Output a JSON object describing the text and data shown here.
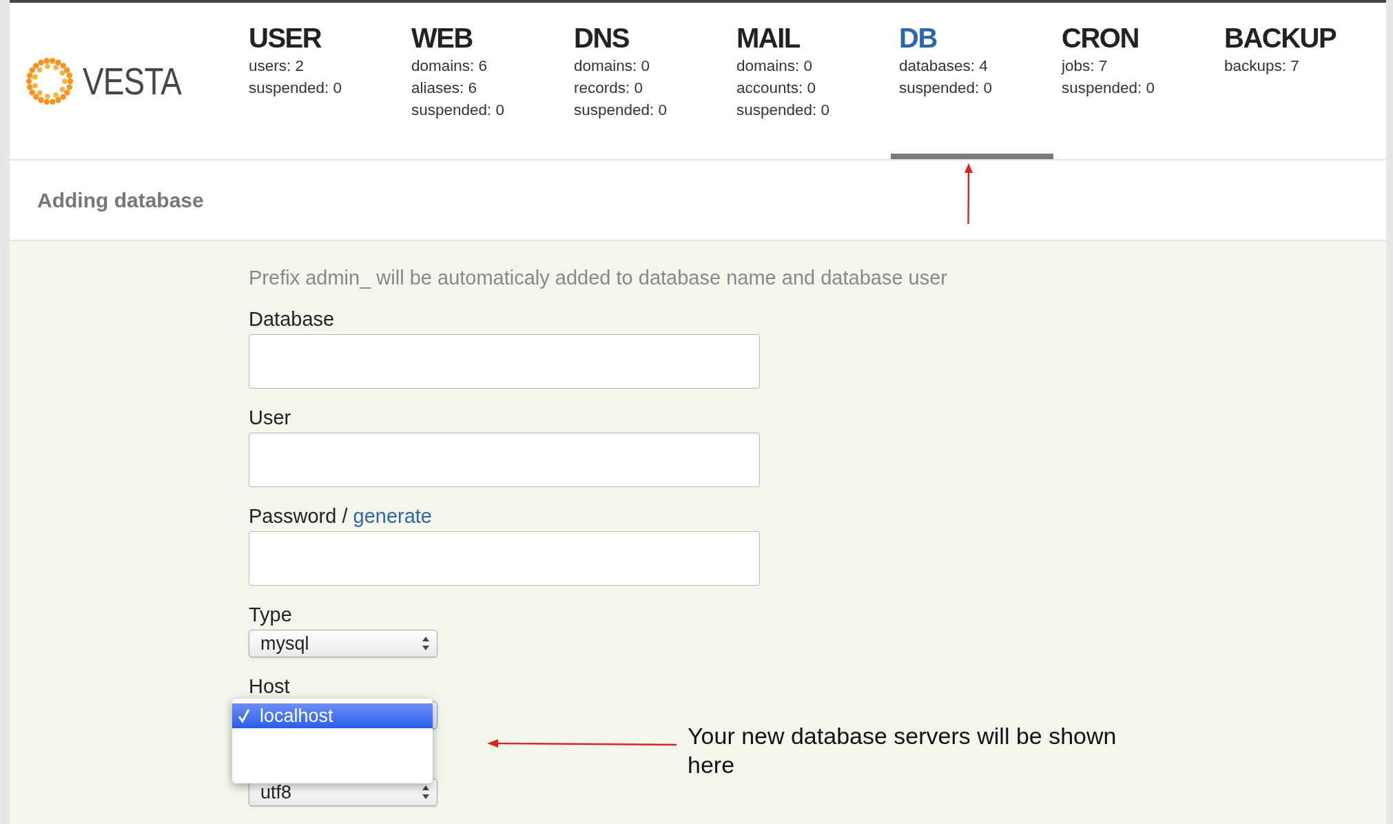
{
  "logo": {
    "text": "VESTA"
  },
  "nav": [
    {
      "title": "USER",
      "stats": [
        "users: 2",
        "suspended: 0"
      ],
      "selected": false
    },
    {
      "title": "WEB",
      "stats": [
        "domains: 6",
        "aliases: 6",
        "suspended: 0"
      ],
      "selected": false
    },
    {
      "title": "DNS",
      "stats": [
        "domains: 0",
        "records: 0",
        "suspended: 0"
      ],
      "selected": false
    },
    {
      "title": "MAIL",
      "stats": [
        "domains: 0",
        "accounts: 0",
        "suspended: 0"
      ],
      "selected": false
    },
    {
      "title": "DB",
      "stats": [
        "databases: 4",
        "suspended: 0"
      ],
      "selected": true
    },
    {
      "title": "CRON",
      "stats": [
        "jobs: 7",
        "suspended: 0"
      ],
      "selected": false
    },
    {
      "title": "BACKUP",
      "stats": [
        "backups: 7"
      ],
      "selected": false
    }
  ],
  "page_title": "Adding database",
  "hint": "Prefix admin_ will be automaticaly added to database name and database user",
  "fields": [
    {
      "kind": "text",
      "label": "Database"
    },
    {
      "kind": "text",
      "label": "User"
    },
    {
      "kind": "text",
      "label": "Password",
      "separator": " / ",
      "link": "generate"
    },
    {
      "kind": "select",
      "label": "Type",
      "value": "mysql"
    },
    {
      "kind": "open-select",
      "label": "Host",
      "options": [
        {
          "label": "localhost",
          "selected": true
        }
      ]
    },
    {
      "kind": "select",
      "value": "utf8"
    }
  ],
  "annotation": "Your new database servers will be shown here"
}
